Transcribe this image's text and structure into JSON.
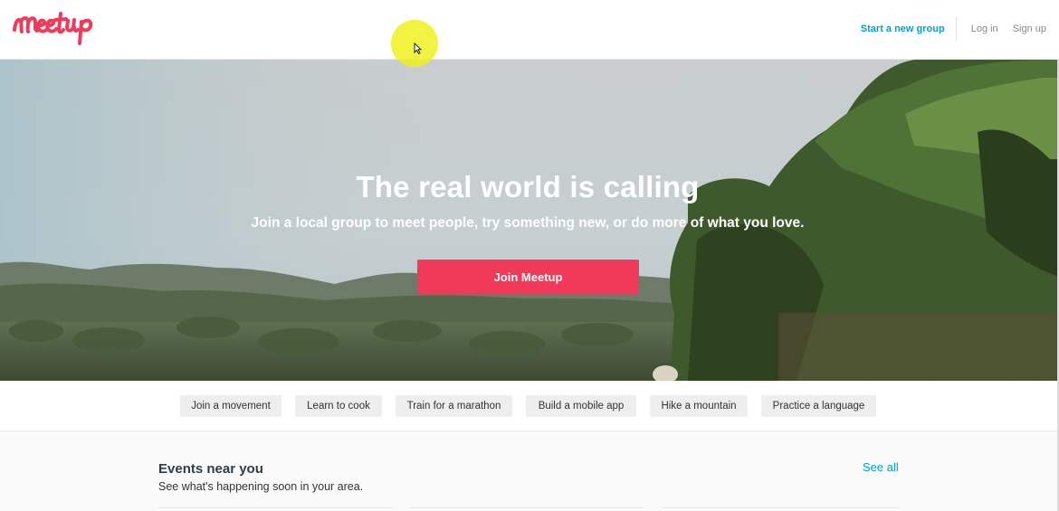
{
  "header": {
    "logo_text": "Meetup",
    "start_group_label": "Start a new group",
    "login_label": "Log in",
    "signup_label": "Sign up"
  },
  "hero": {
    "title": "The real world is calling",
    "subtitle": "Join a local group to meet people, try something new, or do more of what you love.",
    "cta_label": "Join Meetup"
  },
  "topics": [
    "Join a movement",
    "Learn to cook",
    "Train for a marathon",
    "Build a mobile app",
    "Hike a mountain",
    "Practice a language"
  ],
  "events": {
    "title": "Events near you",
    "subtitle": "See what's happening soon in your area.",
    "see_all_label": "See all"
  },
  "colors": {
    "brand": "#f13a59",
    "link": "#00a2c7"
  },
  "icons": {
    "cursor": "mouse-pointer-icon",
    "logo": "meetup-logo"
  }
}
